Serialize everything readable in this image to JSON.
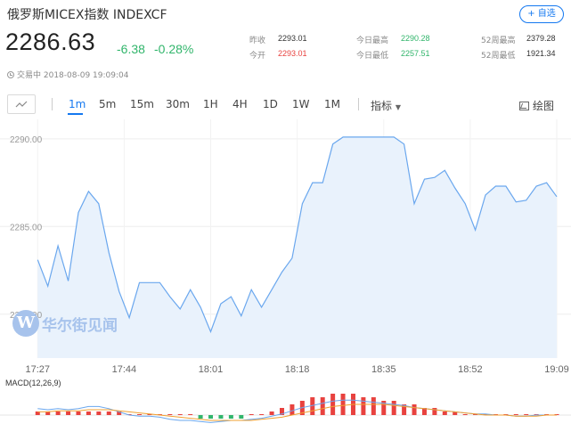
{
  "header": {
    "title": "俄罗斯MICEX指数  INDEXCF",
    "watch_button": "+ 自选"
  },
  "quote": {
    "price": "2286.63",
    "change": "-6.38",
    "change_pct": "-0.28%",
    "status": "交易中 2018-08-09 19:09:04"
  },
  "stats": {
    "prev_close_label": "昨收",
    "prev_close": "2293.01",
    "open_label": "今开",
    "open": "2293.01",
    "high_label": "今日最高",
    "high": "2290.28",
    "low_label": "今日最低",
    "low": "2257.51",
    "w52_high_label": "52周最高",
    "w52_high": "2379.28",
    "w52_low_label": "52周最低",
    "w52_low": "1921.34"
  },
  "toolbar": {
    "chart_type_icon": "line-chart-icon",
    "periods": [
      "1m",
      "5m",
      "15m",
      "30m",
      "1H",
      "4H",
      "1D",
      "1W",
      "1M"
    ],
    "active_period": "1m",
    "indicator_label": "指标",
    "draw_label": "绘图"
  },
  "watermark": {
    "logo": "W",
    "text": "华尔街见闻"
  },
  "colors": {
    "accent": "#1478f0",
    "up": "#e8423f",
    "down": "#31b56b",
    "line": "#6aa7ee",
    "area": "#e9f2fc",
    "macd_dif": "#6aa7ee",
    "macd_dea": "#f0a030"
  },
  "chart_data": {
    "type": "area",
    "title": "",
    "xlabel": "",
    "ylabel": "",
    "x_ticks": [
      "17:27",
      "17:44",
      "18:01",
      "18:18",
      "18:35",
      "18:52",
      "19:09"
    ],
    "y_ticks": [
      "2290.00",
      "2285.00",
      "2280.00"
    ],
    "ylim": [
      2277.5,
      2290.5
    ],
    "grid": true,
    "x": [
      "17:27",
      "17:29",
      "17:31",
      "17:33",
      "17:35",
      "17:37",
      "17:39",
      "17:41",
      "17:43",
      "17:45",
      "17:47",
      "17:49",
      "17:51",
      "17:53",
      "17:55",
      "17:57",
      "17:59",
      "18:01",
      "18:03",
      "18:05",
      "18:07",
      "18:09",
      "18:11",
      "18:13",
      "18:15",
      "18:17",
      "18:19",
      "18:21",
      "18:23",
      "18:25",
      "18:27",
      "18:29",
      "18:31",
      "18:33",
      "18:35",
      "18:37",
      "18:39",
      "18:41",
      "18:43",
      "18:45",
      "18:47",
      "18:49",
      "18:51",
      "18:53",
      "18:55",
      "18:57",
      "18:59",
      "19:01",
      "19:03",
      "19:05",
      "19:07",
      "19:09"
    ],
    "series": [
      {
        "values": [
          2283.1,
          2281.6,
          2283.9,
          2281.9,
          2285.8,
          2287.0,
          2286.3,
          2283.5,
          2281.3,
          2279.8,
          2281.8,
          2281.8,
          2281.8,
          2281.0,
          2280.3,
          2281.4,
          2280.4,
          2279.0,
          2280.6,
          2281.0,
          2279.9,
          2281.4,
          2280.4,
          2281.4,
          2282.4,
          2283.2,
          2286.3,
          2287.5,
          2287.5,
          2289.7,
          2290.1,
          2290.1,
          2290.1,
          2290.1,
          2290.1,
          2290.1,
          2289.7,
          2286.3,
          2287.7,
          2287.8,
          2288.2,
          2287.2,
          2286.3,
          2284.8,
          2286.8,
          2287.3,
          2287.3,
          2286.4,
          2286.5,
          2287.3,
          2287.5,
          2286.7
        ]
      }
    ],
    "macd": {
      "label": "MACD(12,26,9)",
      "histogram": [
        1,
        1,
        1,
        1,
        1,
        1,
        1,
        1,
        1,
        0,
        0,
        0,
        0,
        0,
        0,
        0,
        -1,
        -1,
        -1,
        -1,
        -1,
        0,
        0,
        1,
        2,
        3,
        4,
        5,
        5,
        6,
        6,
        6,
        5,
        5,
        4,
        4,
        3,
        3,
        2,
        2,
        1,
        1,
        0,
        0,
        0,
        0,
        0,
        0,
        0,
        0,
        0,
        0
      ],
      "dif": [
        0.6,
        0.5,
        0.6,
        0.5,
        0.6,
        0.8,
        0.8,
        0.6,
        0.3,
        0.0,
        -0.1,
        -0.1,
        -0.2,
        -0.4,
        -0.5,
        -0.5,
        -0.6,
        -0.7,
        -0.6,
        -0.5,
        -0.5,
        -0.4,
        -0.3,
        -0.1,
        0.1,
        0.4,
        0.7,
        0.9,
        1.1,
        1.3,
        1.4,
        1.4,
        1.3,
        1.2,
        1.1,
        1.0,
        0.9,
        0.7,
        0.6,
        0.5,
        0.4,
        0.3,
        0.2,
        0.1,
        0.1,
        0.0,
        0.0,
        -0.1,
        -0.1,
        0.0,
        0.0,
        0.0
      ],
      "dea": [
        0.3,
        0.3,
        0.4,
        0.4,
        0.4,
        0.5,
        0.5,
        0.5,
        0.4,
        0.3,
        0.2,
        0.1,
        0.0,
        -0.1,
        -0.2,
        -0.3,
        -0.4,
        -0.5,
        -0.5,
        -0.5,
        -0.5,
        -0.5,
        -0.4,
        -0.3,
        -0.2,
        0.0,
        0.2,
        0.4,
        0.6,
        0.8,
        0.9,
        1.0,
        1.0,
        1.0,
        1.0,
        0.9,
        0.8,
        0.7,
        0.6,
        0.5,
        0.4,
        0.3,
        0.2,
        0.1,
        0.0,
        0.0,
        0.0,
        -0.1,
        -0.1,
        -0.1,
        0.0,
        0.0
      ]
    }
  }
}
